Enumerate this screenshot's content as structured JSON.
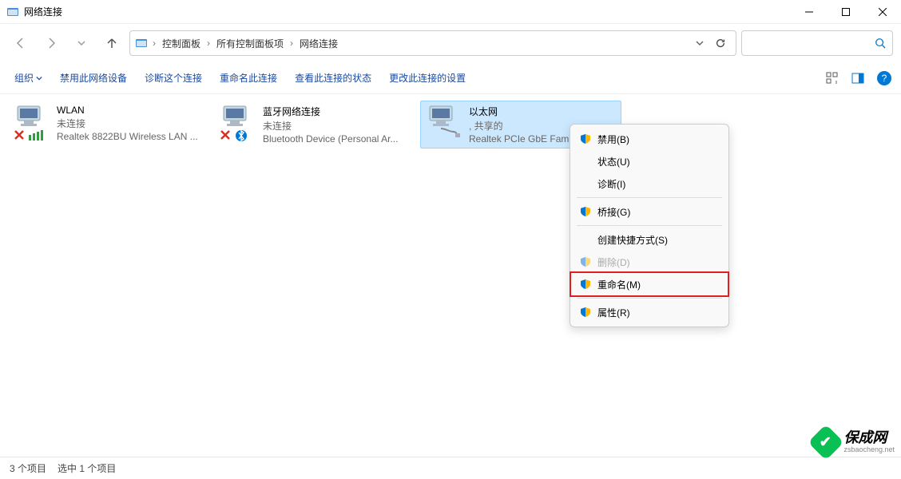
{
  "window": {
    "title": "网络连接"
  },
  "breadcrumbs": {
    "root": "控制面板",
    "mid": "所有控制面板项",
    "leaf": "网络连接"
  },
  "toolbar": {
    "organize": "组织",
    "disable": "禁用此网络设备",
    "diagnose": "诊断这个连接",
    "rename": "重命名此连接",
    "viewstatus": "查看此连接的状态",
    "changesettings": "更改此连接的设置"
  },
  "adapters": [
    {
      "name": "WLAN",
      "status": "未连接",
      "device": "Realtek 8822BU Wireless LAN ..."
    },
    {
      "name": "蓝牙网络连接",
      "status": "未连接",
      "device": "Bluetooth Device (Personal Ar..."
    },
    {
      "name": "以太网",
      "status": ", 共享的",
      "device": "Realtek PCIe GbE Famil..."
    }
  ],
  "context_menu": {
    "disable": "禁用(B)",
    "status": "状态(U)",
    "diagnose": "诊断(I)",
    "bridge": "桥接(G)",
    "shortcut": "创建快捷方式(S)",
    "delete": "删除(D)",
    "rename": "重命名(M)",
    "properties": "属性(R)"
  },
  "statusbar": {
    "count": "3 个项目",
    "selected": "选中 1 个项目"
  },
  "watermark": {
    "name": "保成网",
    "url": "zsbaocheng.net"
  }
}
